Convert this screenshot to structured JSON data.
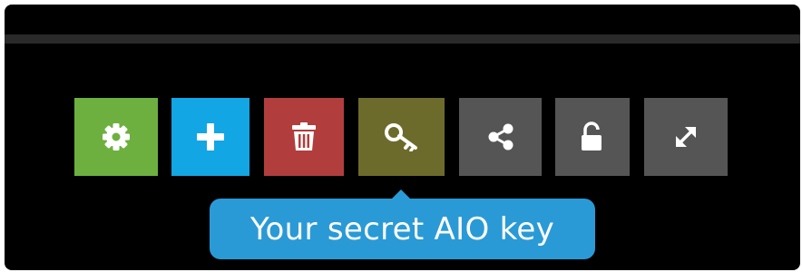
{
  "toolbar": {
    "buttons": [
      {
        "name": "settings",
        "icon": "gear-icon",
        "color": "#6db03f"
      },
      {
        "name": "add",
        "icon": "plus-icon",
        "color": "#12a6e4"
      },
      {
        "name": "delete",
        "icon": "trash-icon",
        "color": "#b23d3d"
      },
      {
        "name": "aio-key",
        "icon": "key-icon",
        "color": "#6c6b2b"
      },
      {
        "name": "share",
        "icon": "share-icon",
        "color": "#555555"
      },
      {
        "name": "unlock",
        "icon": "unlock-icon",
        "color": "#555555"
      },
      {
        "name": "fullscreen",
        "icon": "expand-icon",
        "color": "#555555"
      }
    ]
  },
  "tooltip": {
    "text": "Your secret AIO key",
    "color": "#2a9ad6"
  },
  "colors": {
    "background": "#000000",
    "divider": "#2a2a2a",
    "icon": "#ffffff"
  }
}
